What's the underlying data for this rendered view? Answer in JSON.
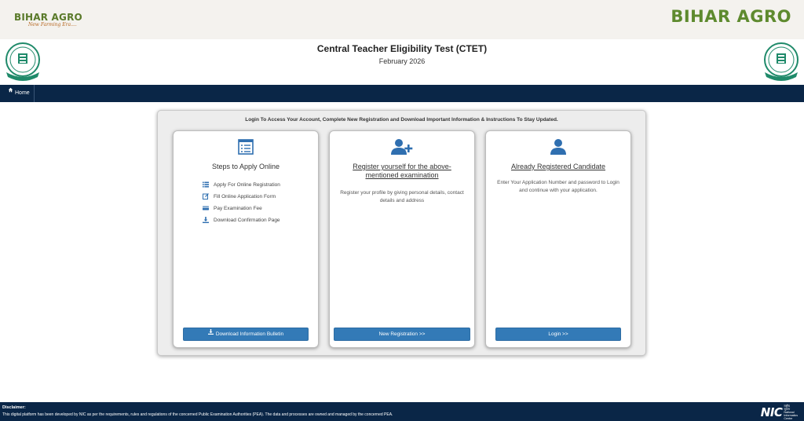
{
  "brand": {
    "left_name": "BIHAR AGRO",
    "left_tagline": "New Farming Era....",
    "right_name": "BIHAR AGRO"
  },
  "header": {
    "title": "Central Teacher Eligibility Test (CTET)",
    "subtitle": "February 2026",
    "logo_icon": "cbse-emblem-icon"
  },
  "nav": {
    "home_label": "Home",
    "home_icon": "home-icon"
  },
  "panel": {
    "message": "Login To Access Your Account, Complete New Registration and Download Important Information & Instructions To Stay Updated."
  },
  "cards": {
    "steps": {
      "icon": "list-document-icon",
      "title": "Steps to Apply Online",
      "items": [
        {
          "label": "Apply For Online Registration",
          "icon": "list-icon"
        },
        {
          "label": "Fill Online Application Form",
          "icon": "edit-form-icon"
        },
        {
          "label": "Pay Examination Fee",
          "icon": "payment-icon"
        },
        {
          "label": "Download Confirmation Page",
          "icon": "download-icon"
        }
      ],
      "button_label": "Download Information Bulletin",
      "button_icon": "download-icon"
    },
    "register": {
      "icon": "user-plus-icon",
      "title": "Register yourself for the above-mentioned examination",
      "description": "Register your profile by giving personal details, contact details and address",
      "button_label": "New Registration >>"
    },
    "login": {
      "icon": "user-icon",
      "title": "Already Registered Candidate",
      "description": "Enter Your Application Number and password to Login and continue with your application.",
      "button_label": "Login >>"
    }
  },
  "footer": {
    "disclaimer_heading": "Disclaimer:",
    "disclaimer_text": "This digital platform has been developed by NIC as per the requirements, rules and regulations of the concerned Public Examination Authorities (PEA). The data and processes are owned and managed by the concerned PEA.",
    "nic_logo_text": "NIC",
    "nic_line1": "राष्ट्रीय",
    "nic_line2": "सूचना",
    "nic_line3": "विज्ञान",
    "nic_line4": "केंद्र",
    "nic_full_1": "National",
    "nic_full_2": "Informatics",
    "nic_full_3": "Centre"
  },
  "colors": {
    "navbar": "#0a2647",
    "primary_button": "#337ab7",
    "brand_green": "#5e8a2e",
    "icon_blue": "#2f6fb0"
  }
}
